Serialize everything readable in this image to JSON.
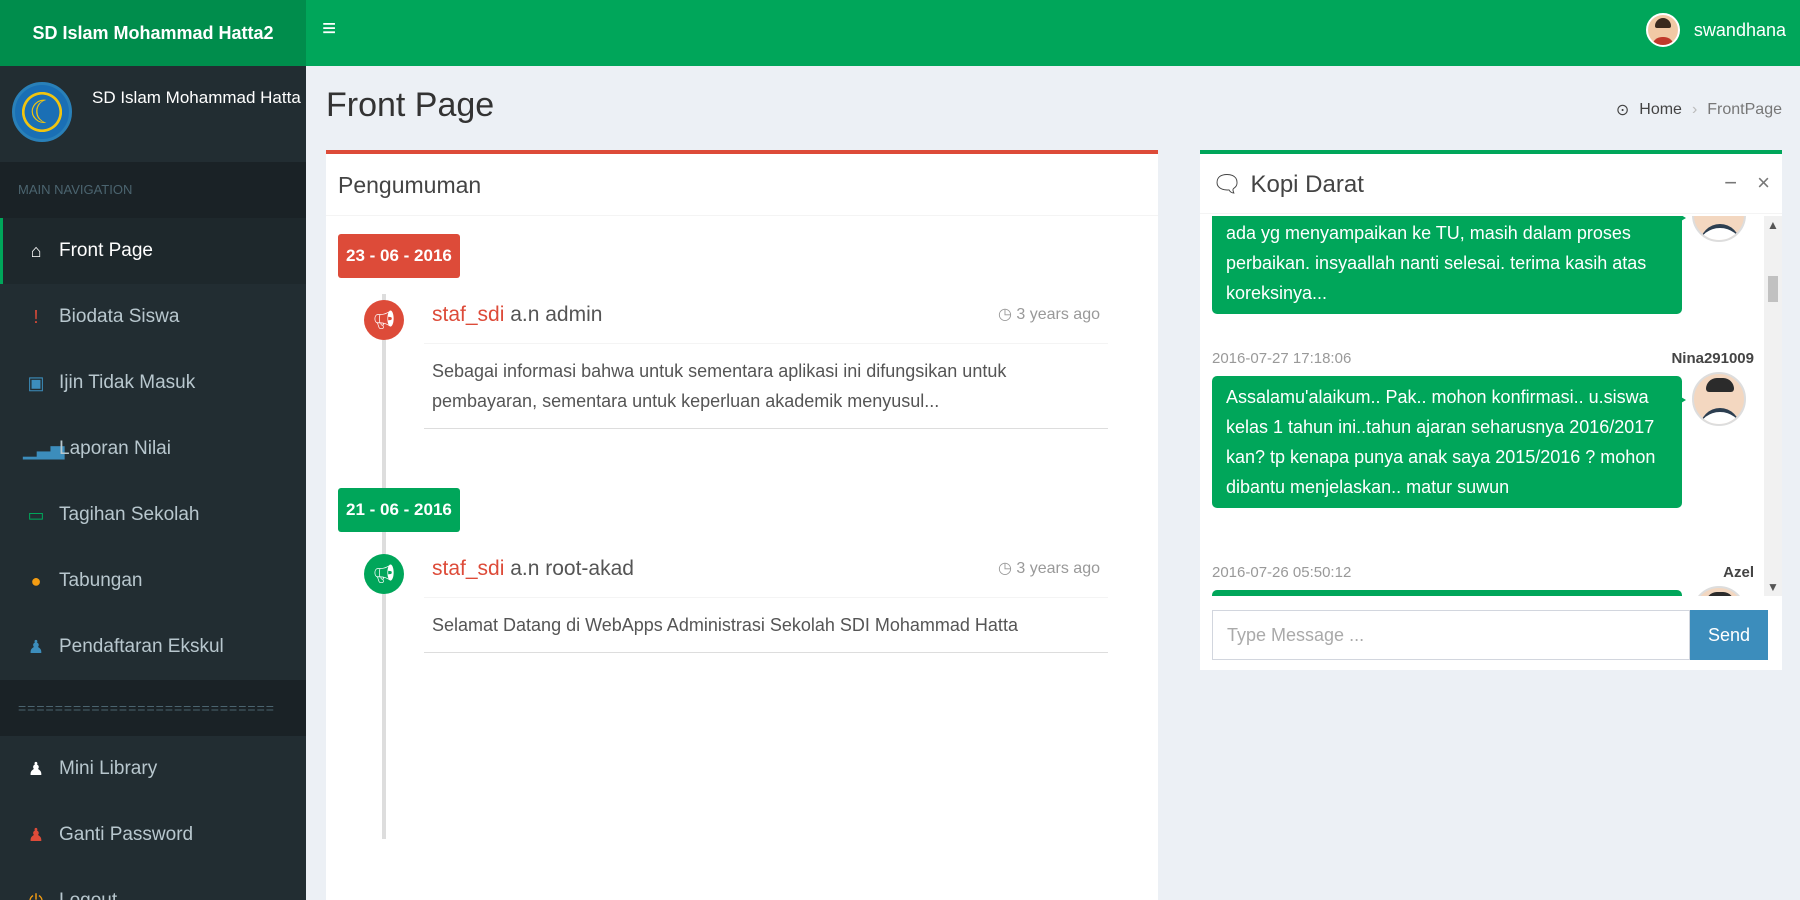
{
  "header": {
    "brand": "SD Islam Mohammad Hatta2",
    "menu_icon": "hamburger-icon",
    "username": "swandhana"
  },
  "sidebar": {
    "school_name": "SD Islam Mohammad Hatta",
    "nav_header": "MAIN NAVIGATION",
    "items": [
      {
        "label": "Front Page",
        "icon": "home-icon",
        "color": "#ffffff"
      },
      {
        "label": "Biodata Siswa",
        "icon": "info-icon",
        "color": "#dd4b39"
      },
      {
        "label": "Ijin Tidak Masuk",
        "icon": "car-icon",
        "color": "#3c8dbc"
      },
      {
        "label": "Laporan Nilai",
        "icon": "bar-chart-icon",
        "color": "#3c8dbc"
      },
      {
        "label": "Tagihan Sekolah",
        "icon": "money-icon",
        "color": "#00a65a"
      },
      {
        "label": "Tabungan",
        "icon": "piggy-bank-icon",
        "color": "#f39c12"
      },
      {
        "label": "Pendaftaran Ekskul",
        "icon": "user-icon",
        "color": "#3c8dbc"
      }
    ],
    "separator": "============================",
    "items2": [
      {
        "label": "Mini Library",
        "icon": "users-icon",
        "color": "#ffffff"
      },
      {
        "label": "Ganti Password",
        "icon": "user-icon",
        "color": "#dd4b39"
      },
      {
        "label": "Logout",
        "icon": "power-icon",
        "color": "#f39c12"
      }
    ]
  },
  "content": {
    "title": "Front Page",
    "breadcrumb": {
      "home": "Home",
      "current": "FrontPage"
    }
  },
  "announcements": {
    "title": "Pengumuman",
    "entries": [
      {
        "date": "23 - 06 - 2016",
        "author": "staf_sdi",
        "on_behalf": "a.n admin",
        "time": "3 years ago",
        "body": "Sebagai informasi bahwa untuk sementara aplikasi ini difungsikan untuk pembayaran, sementara untuk keperluan akademik menyusul...",
        "color": "#dd4b39"
      },
      {
        "date": "21 - 06 - 2016",
        "author": "staf_sdi",
        "on_behalf": "a.n root-akad",
        "time": "3 years ago",
        "body": "Selamat Datang di WebApps Administrasi Sekolah SDI Mohammad Hatta",
        "color": "#00a65a"
      }
    ]
  },
  "chat": {
    "title": "Kopi Darat",
    "minimize": "−",
    "close": "×",
    "messages": [
      {
        "text": "ada yg menyampaikan ke TU, masih dalam proses perbaikan. insyaallah nanti selesai. terima kasih atas koreksinya...",
        "timestamp": "",
        "name": ""
      },
      {
        "text": "Assalamu'alaikum.. Pak.. mohon konfirmasi.. u.siswa kelas 1 tahun ini..tahun ajaran seharusnya 2016/2017 kan? tp kenapa punya anak saya 2015/2016 ? mohon dibantu menjelaskan.. matur suwun",
        "timestamp": "2016-07-27 17:18:06",
        "name": "Nina291009"
      },
      {
        "text": "",
        "timestamp": "2016-07-26 05:50:12",
        "name": "Azel"
      }
    ],
    "input_placeholder": "Type Message ...",
    "send_label": "Send"
  }
}
